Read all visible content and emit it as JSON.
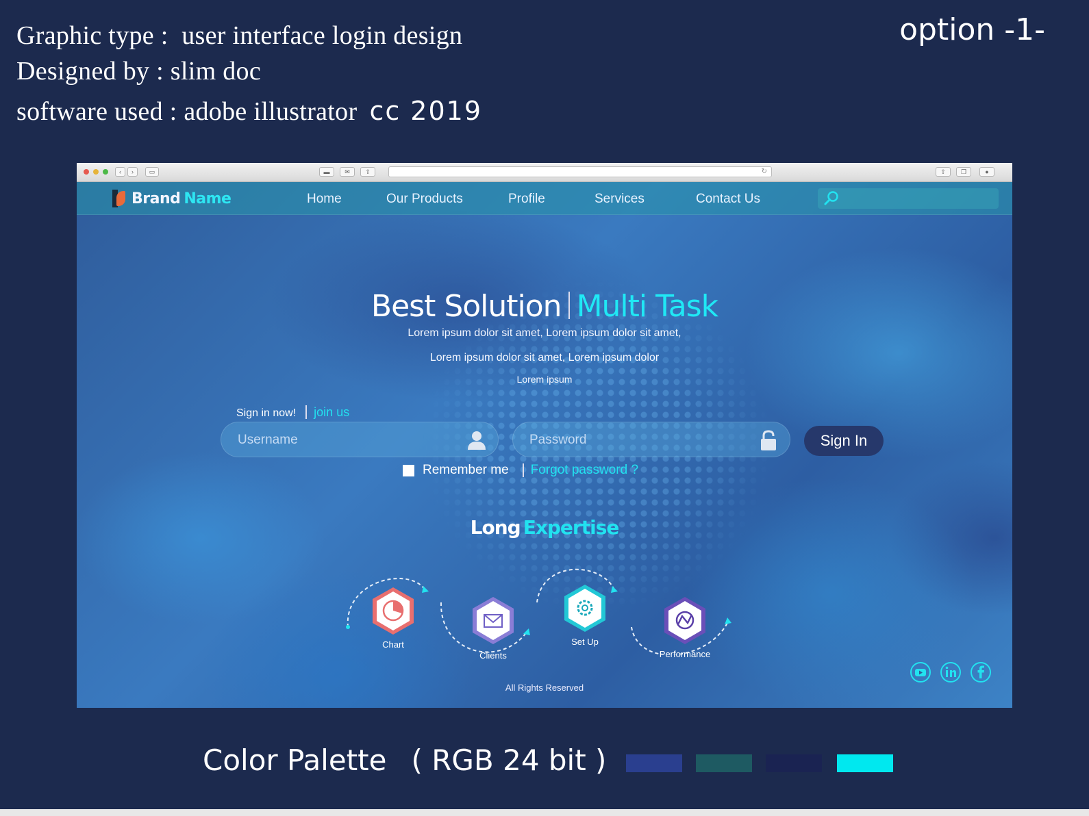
{
  "meta": {
    "graphic_type_label": "Graphic type :",
    "graphic_type_value": "user interface login design",
    "designed_by": "Designed by : slim doc",
    "software_label": "software used : adobe illustrator",
    "software_version": "cc 2019",
    "option": "option -1-"
  },
  "site": {
    "brand_word1": "Brand",
    "brand_word2": "Name",
    "nav": [
      "Home",
      "Our Products",
      "Profile",
      "Services",
      "Contact Us"
    ],
    "hero_title_1": "Best Solution",
    "hero_title_2": "Multi Task",
    "lorem_1": "Lorem ipsum dolor sit amet,  Lorem ipsum dolor sit amet,",
    "lorem_2": "Lorem ipsum dolor sit amet,  Lorem ipsum dolor",
    "lorem_3": "Lorem ipsum",
    "sign_in_now": "Sign in now!",
    "join_us": "join us",
    "username_placeholder": "Username",
    "password_placeholder": "Password",
    "sign_in_button": "Sign In",
    "remember_me": "Remember me",
    "forgot_password": "Forgot password ?",
    "expertise_1": "Long",
    "expertise_2": "Expertise",
    "features": [
      {
        "label": "Chart",
        "icon": "pie-chart-icon"
      },
      {
        "label": "Clients",
        "icon": "envelope-icon"
      },
      {
        "label": "Set Up",
        "icon": "gear-icon"
      },
      {
        "label": "Performance",
        "icon": "performance-icon"
      }
    ],
    "social": [
      "youtube-icon",
      "linkedin-icon",
      "facebook-icon"
    ],
    "footer": "All Rights Reserved"
  },
  "palette": {
    "title": "Color Palette",
    "subtitle": "( RGB 24 bit )",
    "colors": [
      "#2a3f8f",
      "#1e5a62",
      "#1a2352",
      "#00e8ef"
    ]
  }
}
